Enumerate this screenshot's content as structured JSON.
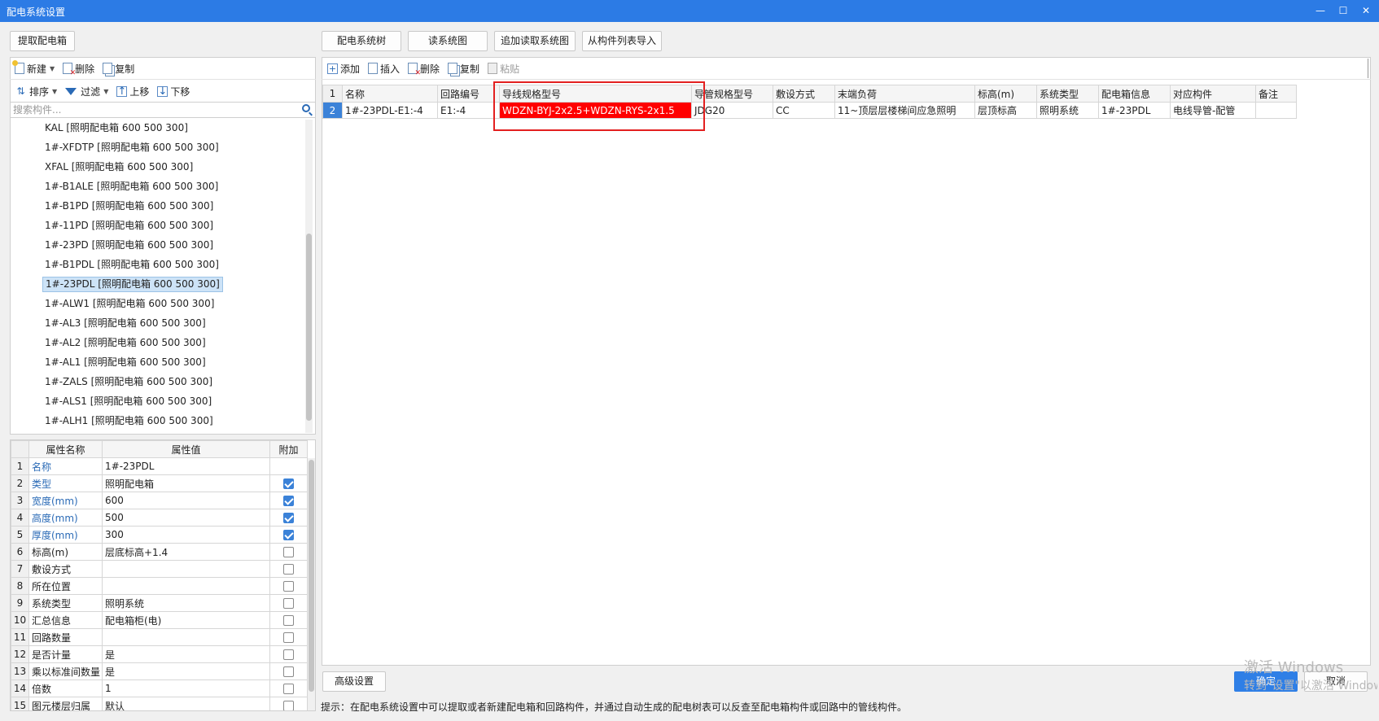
{
  "window": {
    "title": "配电系统设置"
  },
  "left": {
    "extract_button": "提取配电箱",
    "toolbar1": {
      "new": "新建",
      "delete": "删除",
      "copy": "复制"
    },
    "toolbar2": {
      "sort": "排序",
      "filter": "过滤",
      "up": "上移",
      "down": "下移"
    },
    "search_placeholder": "搜索构件...",
    "tree": [
      "KAL [照明配电箱 600 500 300]",
      "1#-XFDTP [照明配电箱 600 500 300]",
      "XFAL [照明配电箱 600 500 300]",
      "1#-B1ALE [照明配电箱 600 500 300]",
      "1#-B1PD [照明配电箱 600 500 300]",
      "1#-11PD [照明配电箱 600 500 300]",
      "1#-23PD [照明配电箱 600 500 300]",
      "1#-B1PDL [照明配电箱 600 500 300]",
      "1#-23PDL [照明配电箱 600 500 300]",
      "1#-ALW1 [照明配电箱 600 500 300]",
      "1#-AL3 [照明配电箱 600 500 300]",
      "1#-AL2 [照明配电箱 600 500 300]",
      "1#-AL1 [照明配电箱 600 500 300]",
      "1#-ZALS [照明配电箱 600 500 300]",
      "1#-ALS1 [照明配电箱 600 500 300]",
      "1#-ALH1 [照明配电箱 600 500 300]"
    ],
    "props": {
      "headers": [
        "属性名称",
        "属性值",
        "附加"
      ],
      "rows": [
        {
          "n": "1",
          "name": "名称",
          "value": "1#-23PDL",
          "blue": true,
          "cb": null
        },
        {
          "n": "2",
          "name": "类型",
          "value": "照明配电箱",
          "blue": true,
          "cb": true
        },
        {
          "n": "3",
          "name": "宽度(mm)",
          "value": "600",
          "blue": true,
          "cb": true
        },
        {
          "n": "4",
          "name": "高度(mm)",
          "value": "500",
          "blue": true,
          "cb": true
        },
        {
          "n": "5",
          "name": "厚度(mm)",
          "value": "300",
          "blue": true,
          "cb": true
        },
        {
          "n": "6",
          "name": "标高(m)",
          "value": "层底标高+1.4",
          "blue": false,
          "cb": false
        },
        {
          "n": "7",
          "name": "敷设方式",
          "value": "",
          "blue": false,
          "cb": false
        },
        {
          "n": "8",
          "name": "所在位置",
          "value": "",
          "blue": false,
          "cb": false
        },
        {
          "n": "9",
          "name": "系统类型",
          "value": "照明系统",
          "blue": false,
          "cb": false
        },
        {
          "n": "10",
          "name": "汇总信息",
          "value": "配电箱柜(电)",
          "blue": false,
          "cb": false
        },
        {
          "n": "11",
          "name": "回路数量",
          "value": "",
          "blue": false,
          "cb": false
        },
        {
          "n": "12",
          "name": "是否计量",
          "value": "是",
          "blue": false,
          "cb": false
        },
        {
          "n": "13",
          "name": "乘以标准间数量",
          "value": "是",
          "blue": false,
          "cb": false
        },
        {
          "n": "14",
          "name": "倍数",
          "value": "1",
          "blue": false,
          "cb": false
        },
        {
          "n": "15",
          "name": "图元楼层归属",
          "value": "默认",
          "blue": false,
          "cb": false
        }
      ]
    }
  },
  "right": {
    "tabs": [
      "配电系统树",
      "读系统图",
      "追加读取系统图",
      "从构件列表导入"
    ],
    "toolbar": {
      "add": "添加",
      "insert": "插入",
      "delete": "删除",
      "copy": "复制",
      "paste": "粘贴"
    },
    "grid": {
      "headers": [
        "名称",
        "回路编号",
        "导线规格型号",
        "导管规格型号",
        "敷设方式",
        "末端负荷",
        "标高(m)",
        "系统类型",
        "配电箱信息",
        "对应构件",
        "备注"
      ],
      "header_row_num": "1",
      "rows": [
        {
          "n": "2",
          "cells": [
            "1#-23PDL-E1:-4",
            "E1:-4",
            "WDZN-BYJ-2x2.5+WDZN-RYS-2x1.5",
            "JDG20",
            "CC",
            "11~顶层层楼梯间应急照明",
            "层顶标高",
            "照明系统",
            "1#-23PDL",
            "电线导管-配管",
            ""
          ]
        }
      ]
    },
    "advanced_button": "高级设置",
    "hint": "提示：在配电系统设置中可以提取或者新建配电箱和回路构件，并通过自动生成的配电树表可以反查至配电箱构件或回路中的管线构件。"
  },
  "footer": {
    "ok": "确定",
    "cancel": "取消"
  },
  "watermark": {
    "line1": "激活 Windows",
    "line2": "转到\"设置\"以激活 Windows。"
  },
  "colors": {
    "titlebar": "#2c7be5",
    "highlight": "#ff0000",
    "checkbox": "#3b82d8"
  }
}
